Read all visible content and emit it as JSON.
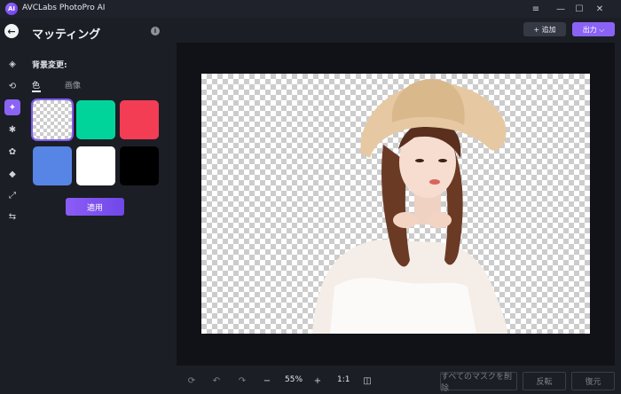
{
  "app": {
    "title": "AVCLabs PhotoPro AI",
    "logo_text": "AI"
  },
  "window": {
    "minimize": "—",
    "maximize": "☐",
    "close": "✕",
    "menu": "≡"
  },
  "panel": {
    "title": "マッティング",
    "section_label": "背景変更:",
    "tabs": [
      {
        "label": "色",
        "active": true
      },
      {
        "label": "画像",
        "active": false
      }
    ],
    "swatches": [
      {
        "color": "transparent",
        "selected": true
      },
      {
        "color": "#00d49a",
        "selected": false
      },
      {
        "color": "#f33d55",
        "selected": false
      },
      {
        "color": "#5785e6",
        "selected": false
      },
      {
        "color": "#ffffff",
        "selected": false
      },
      {
        "color": "#000000",
        "selected": false
      }
    ],
    "apply_label": "適用"
  },
  "toolbar": {
    "add_label": "+ 追加",
    "export_label": "出力 ⌵"
  },
  "bottom": {
    "zoom": "55%",
    "ratio": "1:1",
    "remove_all_masks": "すべてのマスクを削除",
    "invert": "反転",
    "restore": "復元"
  },
  "colors": {
    "accent": "#8a63f5"
  }
}
